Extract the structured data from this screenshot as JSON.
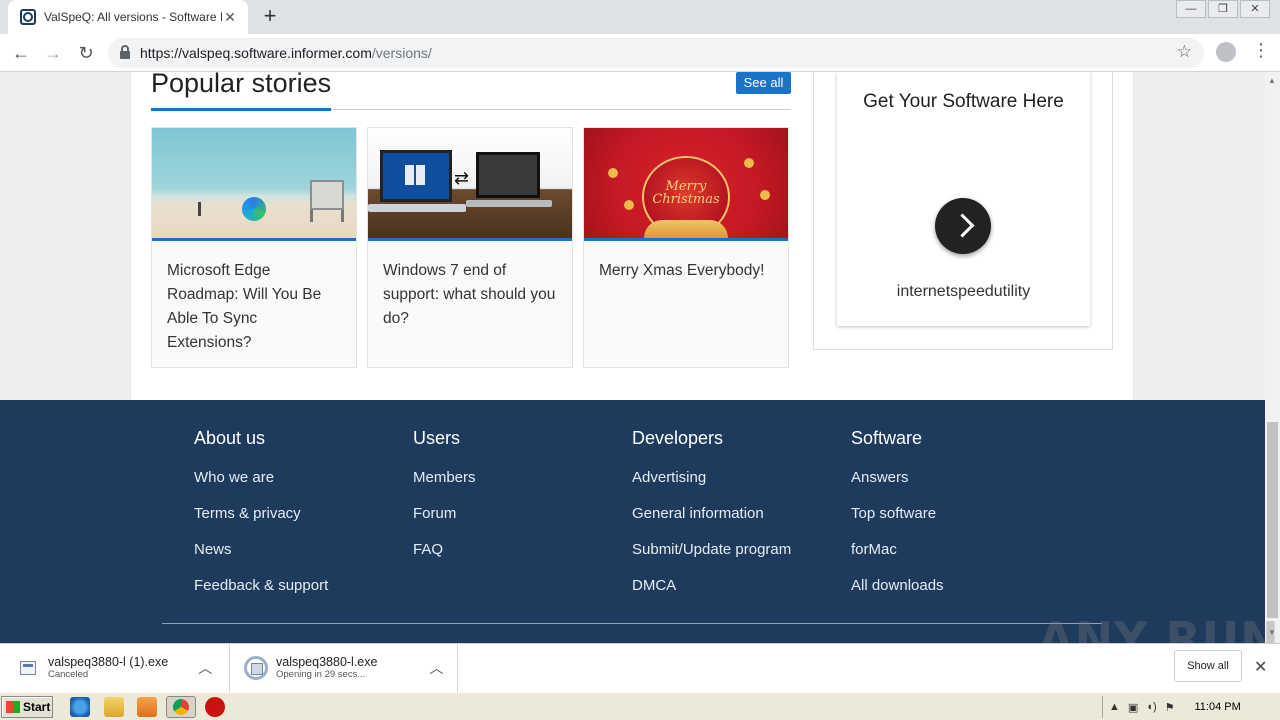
{
  "browser": {
    "tab_title": "ValSpeQ: All versions - Software Informer",
    "tab_close": "✕",
    "new_tab": "+",
    "back": "←",
    "forward": "→",
    "reload": "↻",
    "url_host": "https://valspeq.software.informer.com",
    "url_path": "/versions/",
    "bookmark_icon": "☆",
    "menu_icon": "⋮",
    "window_controls": [
      "—",
      "❐",
      "✕"
    ]
  },
  "popular": {
    "heading": "Popular stories",
    "see_all": "See all",
    "stories": [
      {
        "title": "Microsoft Edge Roadmap: Will You Be Able To Sync Extensions?",
        "image": "beach-edge-logo"
      },
      {
        "title": "Windows 7 end of support: what should you do?",
        "image": "laptops-windows"
      },
      {
        "title": "Merry Xmas Everybody!",
        "image": "christmas-ornament",
        "image_text": "Merry Christmas"
      }
    ]
  },
  "ad": {
    "title": "Get Your Software Here",
    "app_name": "internetspeedutility"
  },
  "footer": {
    "columns": [
      {
        "heading": "About us",
        "links": [
          "Who we are",
          "Terms & privacy",
          "News",
          "Feedback & support"
        ]
      },
      {
        "heading": "Users",
        "links": [
          "Members",
          "Forum",
          "FAQ"
        ]
      },
      {
        "heading": "Developers",
        "links": [
          "Advertising",
          "General information",
          "Submit/Update program",
          "DMCA"
        ]
      },
      {
        "heading": "Software",
        "links": [
          "Answers",
          "Top software",
          "forMac",
          "All downloads"
        ]
      }
    ]
  },
  "downloads": {
    "items": [
      {
        "name": "valspeq3880-l (1).exe",
        "status": "Canceled"
      },
      {
        "name": "valspeq3880-l.exe",
        "status": "Opening in 29 secs..."
      }
    ],
    "show_all": "Show all",
    "close": "✕",
    "chevron": "︿"
  },
  "watermark": "ANY RUN",
  "taskbar": {
    "start": "Start",
    "clock": "11:04 PM"
  },
  "colors": {
    "accent_blue": "#1a73c8",
    "footer_bg": "#1e3a5c"
  }
}
